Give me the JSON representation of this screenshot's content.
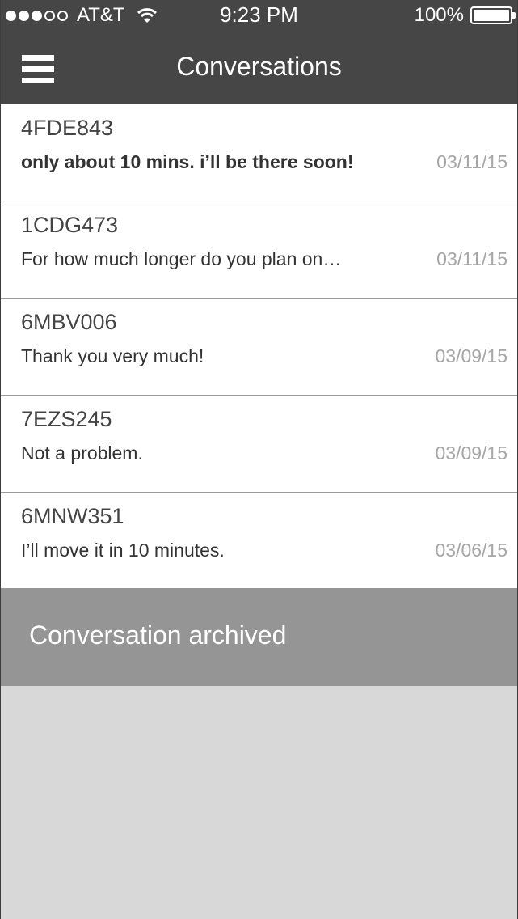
{
  "status_bar": {
    "carrier": "AT&T",
    "time": "9:23 PM",
    "battery": "100%",
    "signal_bars_filled": 3,
    "signal_bars_total": 5
  },
  "header": {
    "title": "Conversations",
    "menu_icon": "hamburger-menu-icon"
  },
  "conversations": [
    {
      "plate": "4FDE843",
      "message": "only about 10 mins. i’ll be there soon!",
      "date": "03/11/15",
      "unread": true
    },
    {
      "plate": "1CDG473",
      "message": "For how much longer do you plan on…",
      "date": "03/11/15",
      "unread": false
    },
    {
      "plate": "6MBV006",
      "message": "Thank you very much!",
      "date": "03/09/15",
      "unread": false
    },
    {
      "plate": "7EZS245",
      "message": "Not a problem.",
      "date": "03/09/15",
      "unread": false
    },
    {
      "plate": "6MNW351",
      "message": "I’ll move it in 10 minutes.",
      "date": "03/06/15",
      "unread": false
    }
  ],
  "toast": {
    "text": "Conversation archived"
  },
  "colors": {
    "header_bg": "#464646",
    "toast_bg": "#959595",
    "empty_bg": "#d8d8d8",
    "date_text": "#a6a6a6"
  }
}
